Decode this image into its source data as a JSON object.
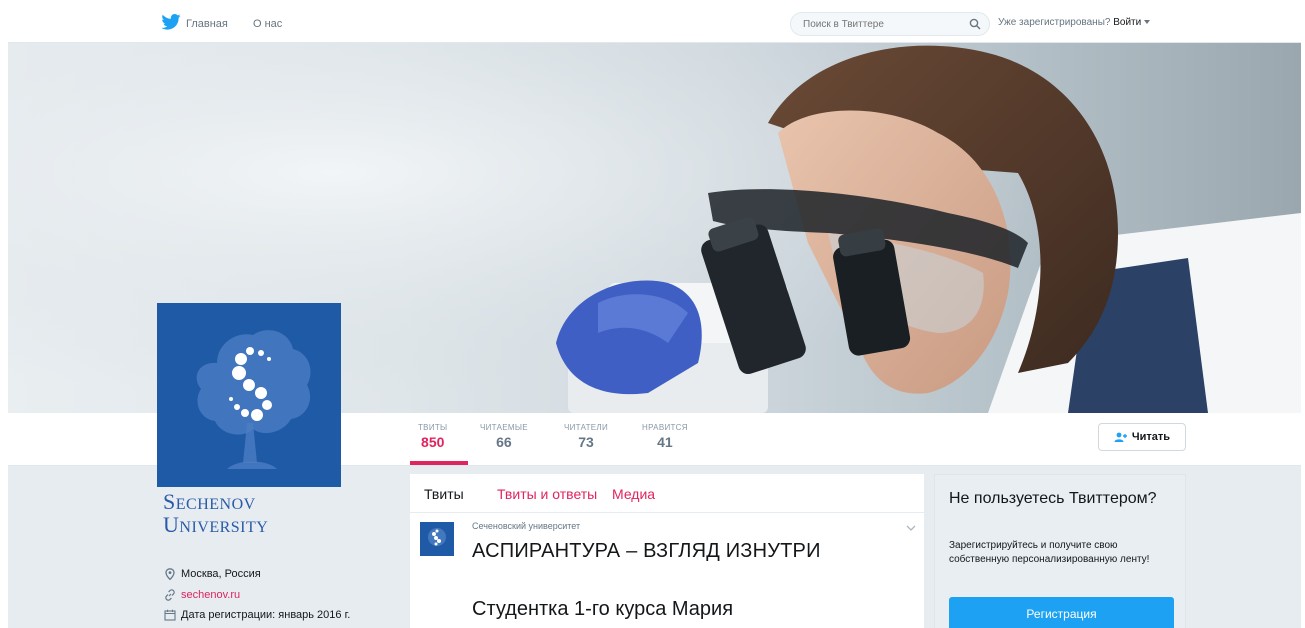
{
  "topnav": {
    "home_label": "Главная",
    "about_label": "О нас",
    "search_placeholder": "Поиск в Твиттере",
    "login_prefix": "Уже зарегистрированы?",
    "login_label": "Войти"
  },
  "profile": {
    "logo_line1": "Sechenov",
    "logo_line2": "University",
    "location": "Москва, Россия",
    "website": "sechenov.ru",
    "joined": "Дата регистрации: январь 2016 г."
  },
  "stats": [
    {
      "label": "ТВИТЫ",
      "value": "850"
    },
    {
      "label": "ЧИТАЕМЫЕ",
      "value": "66"
    },
    {
      "label": "ЧИТАТЕЛИ",
      "value": "73"
    },
    {
      "label": "НРАВИТСЯ",
      "value": "41"
    }
  ],
  "follow_label": "Читать",
  "timeline": {
    "tabs": [
      "Твиты",
      "Твиты и ответы",
      "Медиа"
    ],
    "tweet_author": "Сеченовский университет",
    "tweet_title": "АСПИРАНТУРА – ВЗГЛЯД ИЗНУТРИ",
    "tweet_body": "Студентка 1-го курса Мария"
  },
  "signup": {
    "title": "Не пользуетесь Твиттером?",
    "text": "Зарегистрируйтесь и получите свою собственную персонализированную ленту!",
    "button": "Регистрация"
  },
  "colors": {
    "accent": "#e0245e",
    "brand_blue": "#1da1f2",
    "university_blue": "#1f5aa6"
  }
}
